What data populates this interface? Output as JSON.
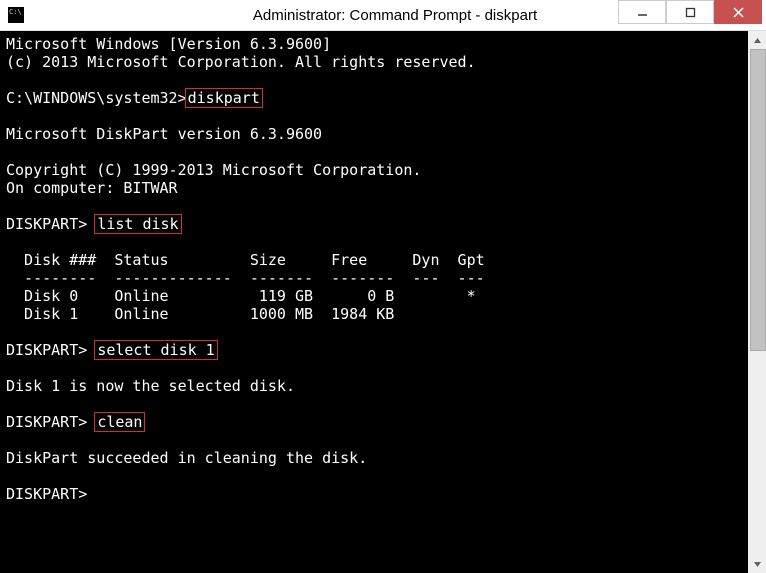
{
  "titlebar": {
    "title": "Administrator: Command Prompt - diskpart"
  },
  "console": {
    "header_line1": "Microsoft Windows [Version 6.3.9600]",
    "header_line2": "(c) 2013 Microsoft Corporation. All rights reserved.",
    "prompt1_path": "C:\\WINDOWS\\system32>",
    "cmd_diskpart": "diskpart",
    "diskpart_version": "Microsoft DiskPart version 6.3.9600",
    "diskpart_copyright": "Copyright (C) 1999-2013 Microsoft Corporation.",
    "diskpart_computer": "On computer: BITWAR",
    "diskpart_prompt": "DISKPART> ",
    "cmd_list_disk": "list disk",
    "table_header": "  Disk ###  Status         Size     Free     Dyn  Gpt",
    "table_separator": "  --------  -------------  -------  -------  ---  ---",
    "table_row0": "  Disk 0    Online          119 GB      0 B        *",
    "table_row1": "  Disk 1    Online         1000 MB  1984 KB",
    "cmd_select_disk": "select disk 1",
    "msg_selected": "Disk 1 is now the selected disk.",
    "cmd_clean": "clean",
    "msg_clean_ok": "DiskPart succeeded in cleaning the disk.",
    "final_prompt": "DISKPART>"
  },
  "scroll": {
    "thumb_top": 0,
    "thumb_height": 300
  }
}
